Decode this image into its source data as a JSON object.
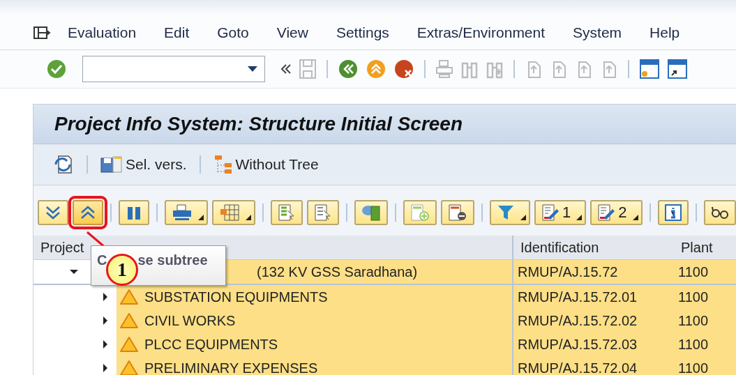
{
  "menu": [
    "Evaluation",
    "Edit",
    "Goto",
    "View",
    "Settings",
    "Extras/Environment",
    "System",
    "Help"
  ],
  "title": "Project Info System: Structure Initial Screen",
  "app_toolbar": [
    {
      "kind": "refresh"
    },
    {
      "kind": "selversion",
      "label": "Sel. vers."
    },
    {
      "kind": "tree",
      "label": "Without Tree"
    }
  ],
  "alv_toolbar": [
    {
      "kind": "expand",
      "dropdown": false,
      "highlighted": false
    },
    {
      "kind": "collapse",
      "dropdown": false,
      "highlighted": true
    },
    {
      "kind": "find",
      "dropdown": false,
      "highlighted": false
    },
    {
      "kind": "print",
      "dropdown": true,
      "highlighted": false
    },
    {
      "kind": "layout",
      "dropdown": true,
      "highlighted": false
    },
    {
      "kind": "doc-green",
      "dropdown": false,
      "highlighted": false
    },
    {
      "kind": "doc-grey",
      "dropdown": false,
      "highlighted": false
    },
    {
      "kind": "database",
      "dropdown": false,
      "highlighted": false
    },
    {
      "kind": "add-row",
      "dropdown": false,
      "highlighted": false
    },
    {
      "kind": "remove-row",
      "dropdown": false,
      "highlighted": false
    },
    {
      "kind": "filter",
      "dropdown": true,
      "highlighted": false
    },
    {
      "kind": "edit",
      "label": "1",
      "dropdown": true,
      "highlighted": false
    },
    {
      "kind": "edit",
      "label": "2",
      "dropdown": true,
      "highlighted": false
    },
    {
      "kind": "info",
      "dropdown": false,
      "highlighted": false
    },
    {
      "kind": "glasses",
      "dropdown": false,
      "highlighted": false
    }
  ],
  "columns": [
    "Project",
    "Identification",
    "Plant"
  ],
  "tooltip": {
    "before": "C",
    "after": "se subtree"
  },
  "annotation": {
    "number": "1"
  },
  "rows": [
    {
      "text": "(132 KV GSS Saradhana)",
      "identification": "RMUP/AJ.15.72",
      "plant": "1100",
      "expanded": true,
      "children": [
        {
          "text": "SUBSTATION EQUIPMENTS",
          "identification": "RMUP/AJ.15.72.01",
          "plant": "1100",
          "expanded": false,
          "warning": true
        },
        {
          "text": "CIVIL WORKS",
          "identification": "RMUP/AJ.15.72.02",
          "plant": "1100",
          "expanded": false,
          "warning": true
        },
        {
          "text": "PLCC EQUIPMENTS",
          "identification": "RMUP/AJ.15.72.03",
          "plant": "1100",
          "expanded": false,
          "warning": true
        },
        {
          "text": "PRELIMINARY EXPENSES",
          "identification": "RMUP/AJ.15.72.04",
          "plant": "1100",
          "expanded": false,
          "warning": true
        }
      ]
    }
  ]
}
